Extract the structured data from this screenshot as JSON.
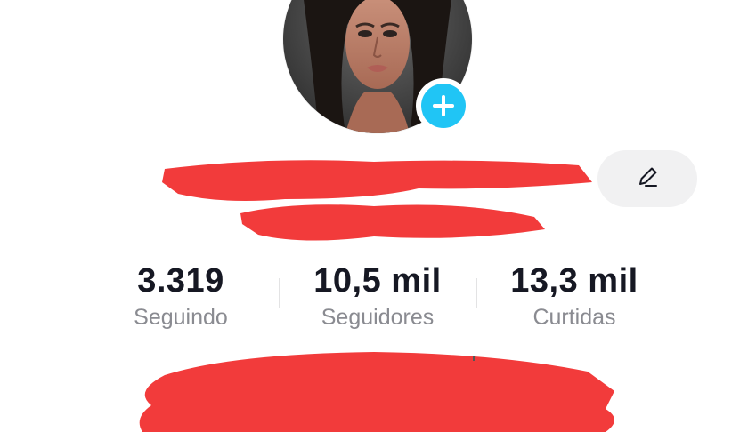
{
  "profile": {
    "avatar_alt": "profile photo",
    "add_icon": "plus-icon",
    "edit_icon": "pencil-icon",
    "accent_color": "#20c5f5"
  },
  "stats": [
    {
      "value": "3.319",
      "label": "Seguindo"
    },
    {
      "value": "10,5 mil",
      "label": "Seguidores"
    },
    {
      "value": "13,3 mil",
      "label": "Curtidas"
    }
  ],
  "redaction_color": "#f23b3b"
}
